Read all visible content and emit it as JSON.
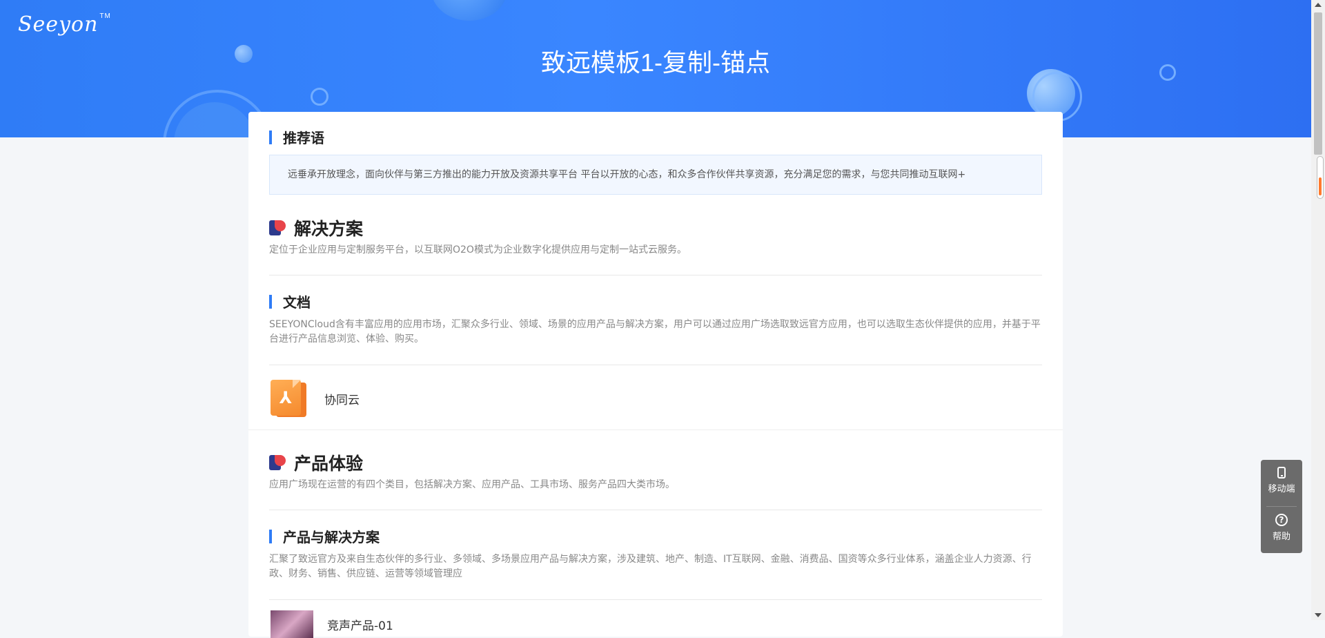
{
  "header": {
    "logo_text": "Seeyon",
    "logo_tm": "TM",
    "title": "致远模板1-复制-锚点"
  },
  "recommend": {
    "heading": "推荐语",
    "text": "远垂承开放理念，面向伙伴与第三方推出的能力开放及资源共享平台 平台以开放的心态，和众多合作伙伴共享资源，充分满足您的需求，与您共同推动互联网+"
  },
  "solutions": {
    "heading": "解决方案",
    "desc": "定位于企业应用与定制服务平台，以互联网O2O模式为企业数字化提供应用与定制一站式云服务。"
  },
  "docs": {
    "heading": "文档",
    "desc": "SEEYONCloud含有丰富应用的应用市场，汇聚众多行业、领域、场景的应用产品与解决方案，用户可以通过应用广场选取致远官方应用，也可以选取生态伙伴提供的应用，并基于平台进行产品信息浏览、体验、购买。",
    "file_name": "协同云"
  },
  "experience": {
    "heading": "产品体验",
    "desc": "应用广场现在运营的有四个类目，包括解决方案、应用产品、工具市场、服务产品四大类市场。"
  },
  "products": {
    "heading": "产品与解决方案",
    "desc": "汇聚了致远官方及来自生态伙伴的多行业、多领域、多场景应用产品与解决方案，涉及建筑、地产、制造、IT互联网、金融、消费品、国资等众多行业体系，涵盖企业人力资源、行政、财务、销售、供应链、运营等领域管理应",
    "item_name": "竞声产品-01"
  },
  "side_tools": {
    "mobile_label": "移动端",
    "help_label": "帮助"
  }
}
